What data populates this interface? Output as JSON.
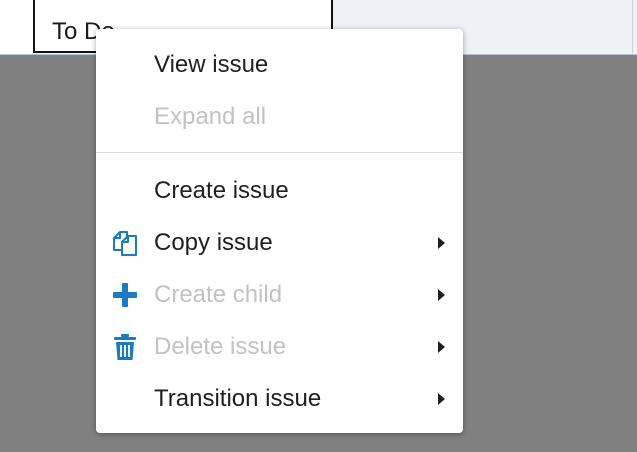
{
  "grid": {
    "selected_cell_text": "To Do"
  },
  "menu": {
    "items": [
      {
        "label": "View issue",
        "disabled": false,
        "icon": null,
        "submenu": false
      },
      {
        "label": "Expand all",
        "disabled": true,
        "icon": null,
        "submenu": false
      },
      {
        "label": "Create issue",
        "disabled": false,
        "icon": null,
        "submenu": false
      },
      {
        "label": "Copy issue",
        "disabled": false,
        "icon": "copy-icon",
        "submenu": true
      },
      {
        "label": "Create child",
        "disabled": true,
        "icon": "plus-icon",
        "submenu": true
      },
      {
        "label": "Delete issue",
        "disabled": true,
        "icon": "trash-icon",
        "submenu": true
      },
      {
        "label": "Transition issue",
        "disabled": false,
        "icon": null,
        "submenu": true
      }
    ]
  },
  "colors": {
    "icon_accent": "#1a7bbf",
    "disabled_text": "#c2c2c2",
    "overlay": "#808080"
  }
}
